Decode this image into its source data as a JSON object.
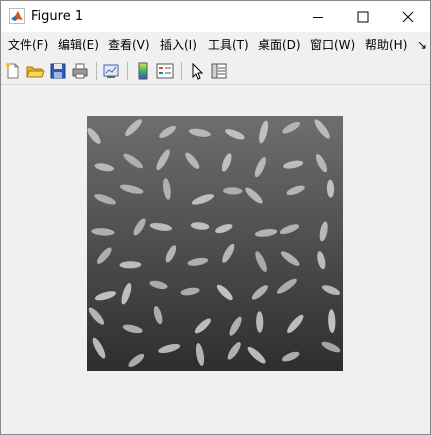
{
  "window": {
    "title": "Figure 1",
    "minimize_glyph": "—",
    "maximize_glyph": "☐",
    "close_glyph": "✕"
  },
  "menu": {
    "items": [
      "文件(F)",
      "编辑(E)",
      "查看(V)",
      "插入(I)",
      "工具(T)",
      "桌面(D)",
      "窗口(W)",
      "帮助(H)"
    ],
    "overflow_glyph": "↘"
  },
  "toolbar": {
    "buttons": [
      "new-figure-icon",
      "open-file-icon",
      "save-icon",
      "print-icon",
      "link-plot-icon",
      "insert-colorbar-icon",
      "insert-legend-icon",
      "edit-plot-icon",
      "property-inspector-icon"
    ]
  },
  "figure": {
    "image_name": "grayscale rice grains image",
    "colors": {
      "background_top": "#6e6e6e",
      "background_bottom": "#2e2e2e",
      "grain": "#c4c4c4"
    }
  }
}
